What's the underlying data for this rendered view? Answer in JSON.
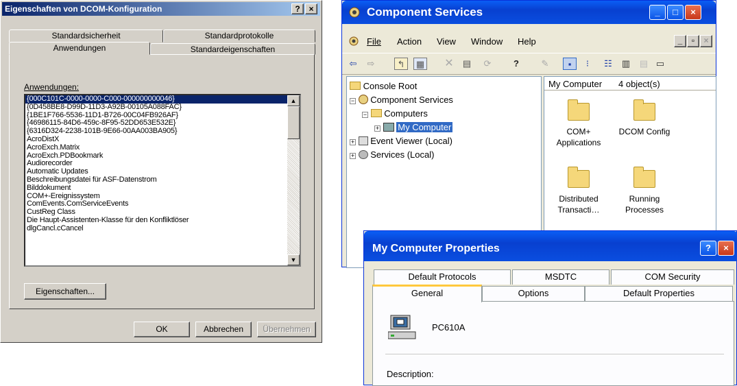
{
  "w2k": {
    "title": "Eigenschaften von DCOM-Konfiguration",
    "help_btn": "?",
    "close_btn": "×",
    "tabs_row1": [
      "Standardsicherheit",
      "Standardprotokolle"
    ],
    "tabs_row2": [
      "Anwendungen",
      "Standardeigenschaften"
    ],
    "list_label": "Anwendungen:",
    "list_items": [
      "{000C101C-0000-0000-C000-000000000046}",
      "{0D458BE8-D99D-11D3-A92B-00105A088FAC}",
      "{1BE1F766-5536-11D1-B726-00C04FB926AF}",
      "{46986115-84D6-459c-8F95-52DD653E532E}",
      "{6316D324-2238-101B-9E66-00AA003BA905}",
      "AcroDistX",
      "AcroExch.Matrix",
      "AcroExch.PDBookmark",
      "Audiorecorder",
      "Automatic Updates",
      "Beschreibungsdatei für ASF-Datenstrom",
      "Bilddokument",
      "COM+-Ereignissystem",
      "ComEvents.ComServiceEvents",
      "CustReg Class",
      "Die Haupt-Assistenten-Klasse für den Konfliktlöser",
      "dlgCancl.cCancel"
    ],
    "selected_index": 0,
    "properties_btn": "Eigenschaften...",
    "ok_btn": "OK",
    "cancel_btn": "Abbrechen",
    "apply_btn": "Übernehmen"
  },
  "cs": {
    "title": "Component Services",
    "menu": [
      "File",
      "Action",
      "View",
      "Window",
      "Help"
    ],
    "window_ctrls": [
      "_",
      "□",
      "×"
    ],
    "inner_ctrls": [
      "_",
      "▫",
      "×"
    ],
    "tree": [
      "Console Root",
      "Component Services",
      "Computers",
      "My Computer",
      "Event Viewer (Local)",
      "Services (Local)"
    ],
    "list_header_name": "My Computer",
    "list_header_count": "4 object(s)",
    "items": [
      {
        "line1": "COM+",
        "line2": "Applications"
      },
      {
        "line1": "DCOM Config",
        "line2": ""
      },
      {
        "line1": "Distributed",
        "line2": "Transacti…"
      },
      {
        "line1": "Running",
        "line2": "Processes"
      }
    ],
    "colors": {
      "title_blue": "#0a4ee0",
      "folder": "#f5d77a",
      "selection": "#316ac5"
    }
  },
  "mcp": {
    "title": "My Computer Properties",
    "help_btn": "?",
    "close_btn": "×",
    "tabs_row1": [
      "Default Protocols",
      "MSDTC",
      "COM Security"
    ],
    "tabs_row2": [
      "General",
      "Options",
      "Default Properties"
    ],
    "computer_name": "PC610A",
    "description_label": "Description:"
  }
}
